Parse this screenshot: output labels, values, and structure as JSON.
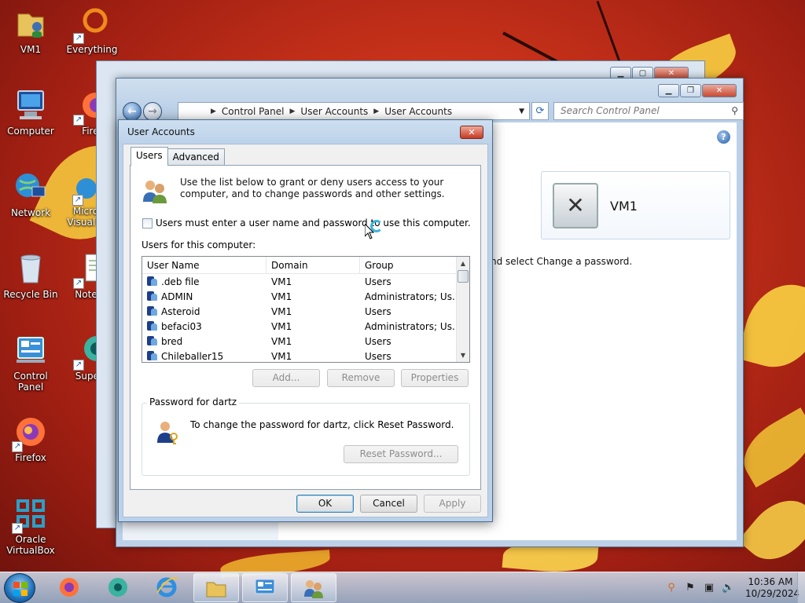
{
  "desktop": {
    "icons": [
      {
        "label": "VM1",
        "icon": "user-folder-icon"
      },
      {
        "label": "Everything",
        "icon": "everything-search-icon"
      },
      {
        "label": "Computer",
        "icon": "computer-icon"
      },
      {
        "label": "Firef",
        "icon": "firefox-icon"
      },
      {
        "label": "Network",
        "icon": "network-icon"
      },
      {
        "label": "Micro Visual S",
        "icon": "visual-studio-icon"
      },
      {
        "label": "Recycle Bin",
        "icon": "recycle-bin-icon"
      },
      {
        "label": "Notepa",
        "icon": "notepad-icon"
      },
      {
        "label": "Control Panel",
        "icon": "control-panel-icon"
      },
      {
        "label": "Supern",
        "icon": "supernova-icon"
      },
      {
        "label": "Firefox",
        "icon": "firefox-icon"
      },
      {
        "label": "Oracle VirtualBox",
        "icon": "virtualbox-icon"
      }
    ]
  },
  "control_panel": {
    "breadcrumb": [
      "Control Panel",
      "User Accounts",
      "User Accounts"
    ],
    "search_placeholder": "Search Control Panel",
    "user_tile_name": "VM1",
    "body_text": "nd select Change a password."
  },
  "dialog": {
    "title": "User Accounts",
    "tabs": [
      "Users",
      "Advanced"
    ],
    "active_tab": "Users",
    "intro": "Use the list below to grant or deny users access to your computer, and to change passwords and other settings.",
    "checkbox_label": "Users must enter a user name and password to use this computer.",
    "checkbox_checked": false,
    "users_label": "Users for this computer:",
    "columns": [
      "User Name",
      "Domain",
      "Group"
    ],
    "rows": [
      {
        "name": ".deb file",
        "domain": "VM1",
        "group": "Users"
      },
      {
        "name": "ADMIN",
        "domain": "VM1",
        "group": "Administrators; Us..."
      },
      {
        "name": "Asteroid",
        "domain": "VM1",
        "group": "Users"
      },
      {
        "name": "befaci03",
        "domain": "VM1",
        "group": "Administrators; Us..."
      },
      {
        "name": "bred",
        "domain": "VM1",
        "group": "Users"
      },
      {
        "name": "Chileballer15",
        "domain": "VM1",
        "group": "Users"
      }
    ],
    "buttons": {
      "add": "Add...",
      "remove": "Remove",
      "properties": "Properties"
    },
    "password_group_title": "Password for dartz",
    "password_text": "To change the password for dartz, click Reset Password.",
    "reset_password": "Reset Password...",
    "ok": "OK",
    "cancel": "Cancel",
    "apply": "Apply"
  },
  "taskbar": {
    "time": "10:36 AM",
    "date": "10/29/2024",
    "pinned": [
      "firefox-icon",
      "supernova-icon",
      "internet-explorer-icon",
      "explorer-folder-icon",
      "control-panel-icon",
      "user-accounts-icon"
    ]
  }
}
